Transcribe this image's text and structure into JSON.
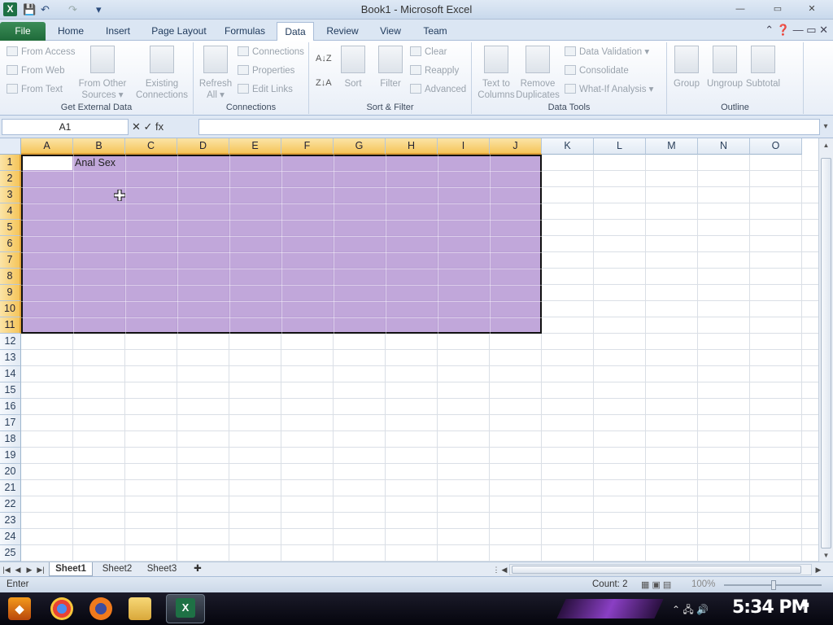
{
  "window": {
    "title": "Book1 - Microsoft Excel",
    "app_icon_letter": "X",
    "qat": {
      "save": "💾",
      "undo": "↶",
      "redo": "↷",
      "customize": "▾"
    },
    "controls": {
      "minimize": "—",
      "maximize": "▭",
      "close": "✕"
    }
  },
  "ribbon_tabs": [
    "File",
    "Home",
    "Insert",
    "Page Layout",
    "Formulas",
    "Data",
    "Review",
    "View",
    "Team"
  ],
  "active_tab": "Data",
  "ribbon_right_icons": "⌃ ❓ — ▭ ✕",
  "ribbon": {
    "get_external": {
      "label": "Get External Data",
      "from_access": "From Access",
      "from_web": "From Web",
      "from_text": "From Text",
      "from_other_1": "From Other",
      "from_other_2": "Sources ▾",
      "existing_1": "Existing",
      "existing_2": "Connections"
    },
    "connections": {
      "label": "Connections",
      "refresh_1": "Refresh",
      "refresh_2": "All ▾",
      "connections": "Connections",
      "properties": "Properties",
      "edit_links": "Edit Links"
    },
    "sort_filter": {
      "label": "Sort & Filter",
      "sort": "Sort",
      "filter": "Filter",
      "clear": "Clear",
      "reapply": "Reapply",
      "advanced": "Advanced"
    },
    "data_tools": {
      "label": "Data Tools",
      "text_to_1": "Text to",
      "text_to_2": "Columns",
      "remove_1": "Remove",
      "remove_2": "Duplicates",
      "data_validation": "Data Validation ▾",
      "consolidate": "Consolidate",
      "what_if": "What-If Analysis ▾"
    },
    "outline": {
      "label": "Outline",
      "group": "Group",
      "ungroup": "Ungroup",
      "subtotal": "Subtotal"
    }
  },
  "formula_bar": {
    "name_box": "A1",
    "buttons": "✕ ✓ fx",
    "value": ""
  },
  "columns": [
    "A",
    "B",
    "C",
    "D",
    "E",
    "F",
    "G",
    "H",
    "I",
    "J",
    "K",
    "L",
    "M",
    "N",
    "O"
  ],
  "rows": [
    "1",
    "2",
    "3",
    "4",
    "5",
    "6",
    "7",
    "8",
    "9",
    "10",
    "11",
    "12",
    "13",
    "14",
    "15",
    "16",
    "17",
    "18",
    "19",
    "20",
    "21",
    "22",
    "23",
    "24",
    "25"
  ],
  "cells": {
    "B1": "Anal Sex"
  },
  "sheets": [
    "Sheet1",
    "Sheet2",
    "Sheet3"
  ],
  "active_sheet": "Sheet1",
  "status": {
    "mode": "Enter",
    "count": "Count: 2",
    "zoom": "100%"
  },
  "taskbar": {
    "clock": "5:34 PM",
    "excel_letter": "X"
  }
}
